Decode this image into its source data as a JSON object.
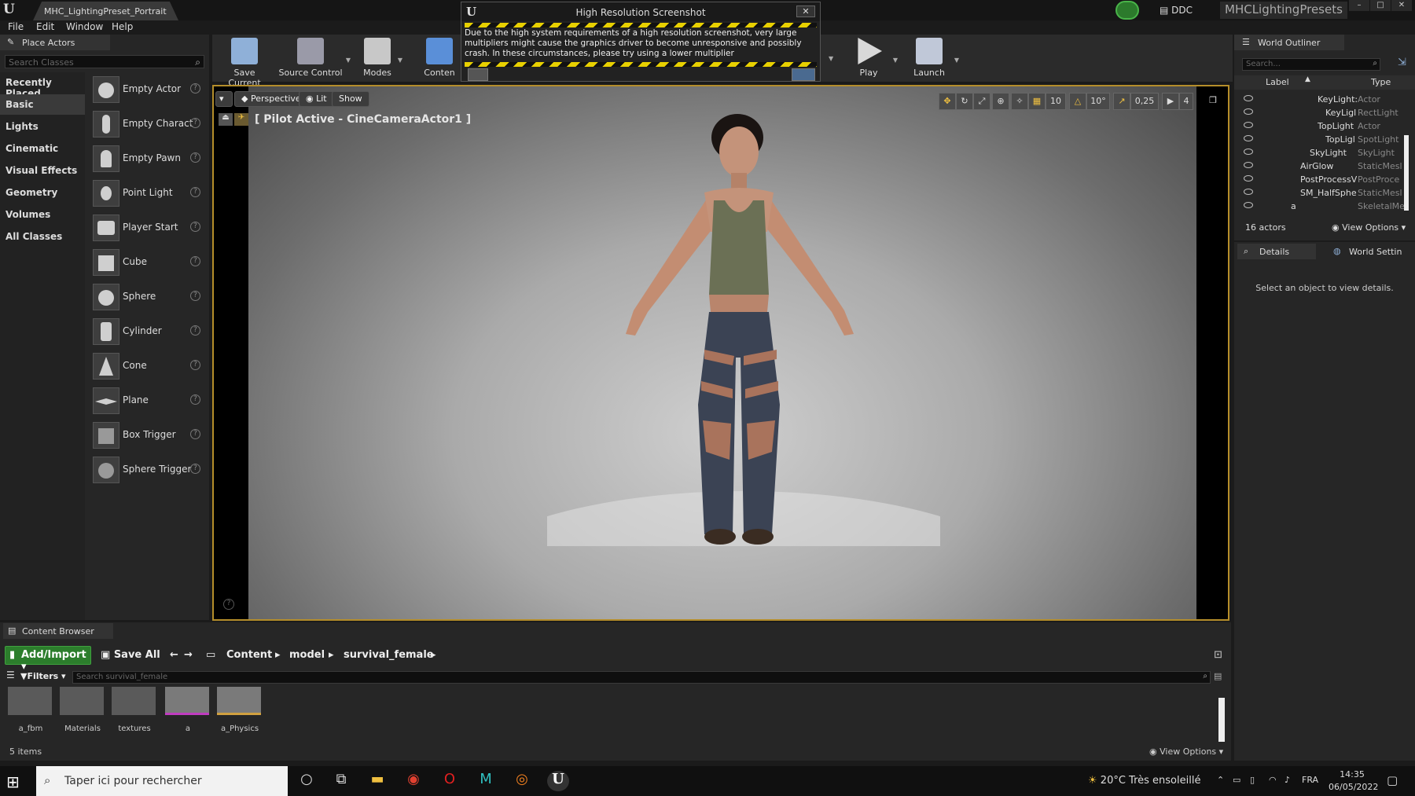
{
  "window": {
    "doc_tab": "MHC_LightingPreset_Portrait",
    "ddc": "DDC",
    "project": "MHCLightingPresets",
    "controls": [
      "–",
      "□",
      "✕"
    ]
  },
  "menu": [
    "File",
    "Edit",
    "Window",
    "Help"
  ],
  "place_actors": {
    "tab": "Place Actors",
    "search_placeholder": "Search Classes",
    "categories": [
      "Recently Placed",
      "Basic",
      "Lights",
      "Cinematic",
      "Visual Effects",
      "Geometry",
      "Volumes",
      "All Classes"
    ],
    "selected_category": "Basic",
    "actors": [
      "Empty Actor",
      "Empty Charact",
      "Empty Pawn",
      "Point Light",
      "Player Start",
      "Cube",
      "Sphere",
      "Cylinder",
      "Cone",
      "Plane",
      "Box Trigger",
      "Sphere Trigger"
    ]
  },
  "toolbar": {
    "save_current": "Save Current",
    "source_control": "Source Control",
    "modes": "Modes",
    "content": "Conten",
    "play": "Play",
    "launch": "Launch"
  },
  "hr_dialog": {
    "title": "High Resolution Screenshot",
    "message": "Due to the high system requirements of a high resolution screenshot, very large multipliers might cause the graphics driver to become unresponsive and possibly crash. In these circumstances, please try using a lower multiplier",
    "close": "✕"
  },
  "viewport": {
    "perspective": "Perspective",
    "lit": "Lit",
    "show": "Show",
    "pilot_label": "[ Pilot Active - CineCameraActor1 ]",
    "grid_snap": "10",
    "rot_snap": "10°",
    "scale_snap": "0,25",
    "cam_speed": "4"
  },
  "outliner": {
    "tab": "World Outliner",
    "search_placeholder": "Search...",
    "col_label": "Label",
    "col_type": "Type",
    "rows": [
      {
        "name": "KeyLight:",
        "type": "Actor"
      },
      {
        "name": "KeyLigl",
        "type": "RectLight"
      },
      {
        "name": "TopLight",
        "type": "Actor"
      },
      {
        "name": "TopLigl",
        "type": "SpotLight"
      },
      {
        "name": "SkyLight",
        "type": "SkyLight"
      },
      {
        "name": "AirGlow",
        "type": "StaticMesl"
      },
      {
        "name": "PostProcessV",
        "type": "PostProce"
      },
      {
        "name": "SM_HalfSpher",
        "type": "StaticMesl"
      },
      {
        "name": "a",
        "type": "SkeletalMe"
      }
    ],
    "count": "16 actors",
    "view_options": "View Options"
  },
  "details": {
    "tab": "Details",
    "world_settings_tab": "World Settin",
    "empty_msg": "Select an object to view details."
  },
  "content_browser": {
    "tab": "Content Browser",
    "add_import": "Add/Import",
    "save_all": "Save All",
    "path": [
      "Content",
      "model",
      "survival_female"
    ],
    "filters": "Filters",
    "search_placeholder": "Search survival_female",
    "assets": [
      "a_fbm",
      "Materials",
      "textures",
      "a",
      "a_Physics"
    ],
    "count": "5 items",
    "view_options": "View Options"
  },
  "taskbar": {
    "search_placeholder": "Taper ici pour rechercher",
    "weather": "20°C  Très ensoleillé",
    "lang": "FRA",
    "time": "14:35",
    "date": "06/05/2022"
  }
}
